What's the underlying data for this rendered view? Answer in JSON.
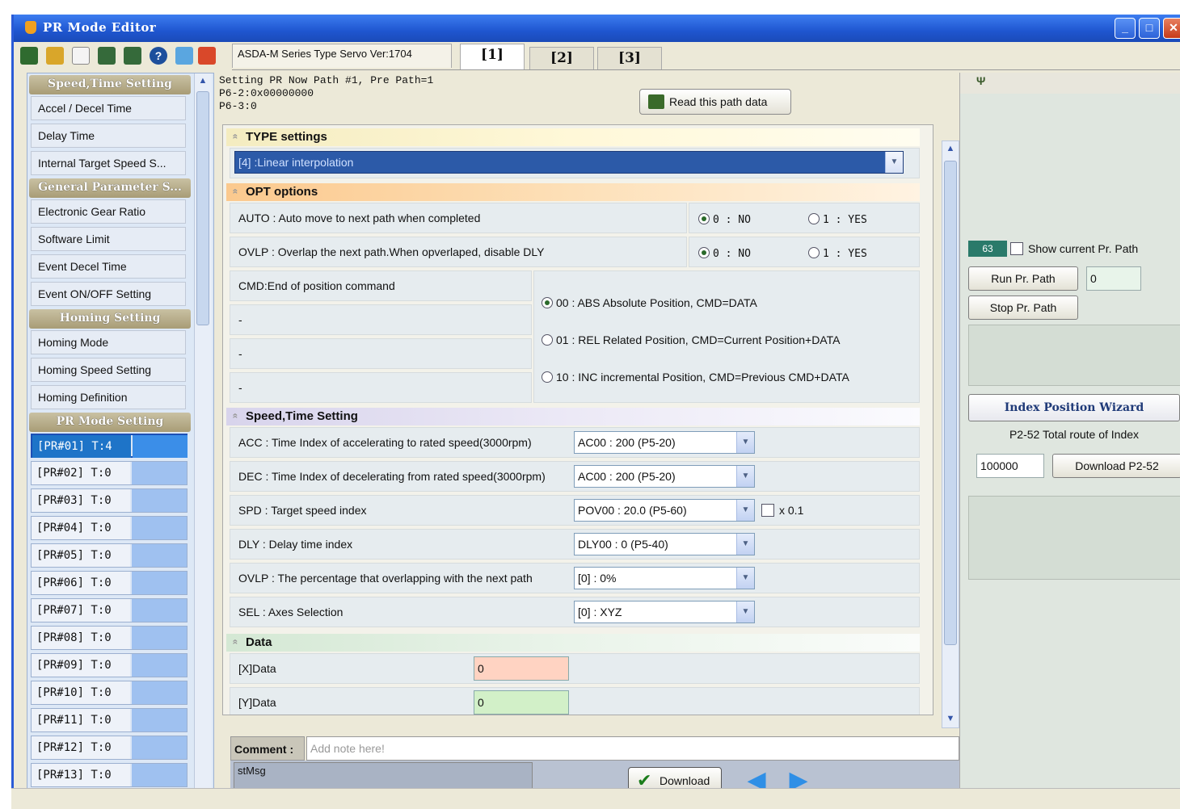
{
  "window": {
    "title": "PR Mode Editor"
  },
  "toolbar": {
    "version_label": "ASDA-M Series Type Servo Ver:1704",
    "tabs": [
      "[1]",
      "[2]",
      "[3]"
    ],
    "icons": [
      "save-icon",
      "open-folder-icon",
      "new-file-icon",
      "read-from-drive-icon",
      "write-to-drive-icon",
      "help-icon",
      "wizard-icon",
      "exit-icon"
    ]
  },
  "sidebar": {
    "groups": {
      "speed_time": "Speed,Time Setting",
      "general": "General Parameter S...",
      "homing": "Homing Setting",
      "pr_mode": "PR Mode Setting"
    },
    "speed_items": [
      "Accel / Decel Time",
      "Delay Time",
      "Internal Target Speed S..."
    ],
    "general_items": [
      "Electronic Gear Ratio",
      "Software Limit",
      "Event Decel Time",
      "Event ON/OFF Setting"
    ],
    "homing_items": [
      "Homing Mode",
      "Homing Speed Setting",
      "Homing Definition"
    ],
    "pr_items": [
      "[PR#01]  T:4",
      "[PR#02]  T:0",
      "[PR#03]  T:0",
      "[PR#04]  T:0",
      "[PR#05]  T:0",
      "[PR#06]  T:0",
      "[PR#07]  T:0",
      "[PR#08]  T:0",
      "[PR#09]  T:0",
      "[PR#10]  T:0",
      "[PR#11]  T:0",
      "[PR#12]  T:0",
      "[PR#13]  T:0"
    ]
  },
  "main": {
    "path_info_line1": "Setting PR Now Path #1, Pre Path=1",
    "path_info_line2": "P6-2:0x00000000",
    "path_info_line3": "P6-3:0",
    "read_button": "Read this path data",
    "type_section": "TYPE settings",
    "type_value": "[4] :Linear interpolation",
    "opt_section": "OPT options",
    "auto_label": "AUTO : Auto move to next path when completed",
    "ovlp_label": "OVLP : Overlap the next path.When opverlaped, disable DLY",
    "no_option": "0 : NO",
    "yes_option": "1 : YES",
    "cmd_label": "CMD:End of position command",
    "dash": "-",
    "cmd_options": [
      "00 : ABS Absolute Position, CMD=DATA",
      "01 : REL Related Position, CMD=Current Position+DATA",
      "10 : INC incremental Position, CMD=Previous CMD+DATA"
    ],
    "speed_section": "Speed,Time Setting",
    "acc_label": "ACC : Time Index of accelerating to rated speed(3000rpm)",
    "acc_value": "AC00 : 200 (P5-20)",
    "dec_label": "DEC : Time Index of decelerating from rated speed(3000rpm)",
    "dec_value": "AC00 : 200 (P5-20)",
    "spd_label": "SPD : Target speed index",
    "spd_value": "POV00 : 20.0 (P5-60)",
    "x01_label": "x 0.1",
    "dly_label": "DLY : Delay time index",
    "dly_value": "DLY00 : 0 (P5-40)",
    "ovlp_pct_label": "OVLP : The percentage that overlapping with the next path",
    "ovlp_pct_value": "[0] : 0%",
    "sel_label": "SEL : Axes Selection",
    "sel_value": "[0] : XYZ",
    "data_section": "Data",
    "x_data_label": "[X]Data",
    "x_data_value": "0",
    "y_data_label": "[Y]Data",
    "y_data_value": "0",
    "comment_label": "Comment :",
    "comment_placeholder": "Add note here!",
    "stmsg": "stMsg",
    "download_button": "Download"
  },
  "right": {
    "pin": "Ψ",
    "pr_count": "63",
    "show_current": "Show current Pr. Path",
    "run_button": "Run Pr. Path",
    "run_value": "0",
    "stop_button": "Stop Pr. Path",
    "wizard_button": "Index Position Wizard",
    "p252_label": "P2-52 Total route of Index",
    "p252_value": "100000",
    "download_p252": "Download P2-52"
  },
  "colors": {
    "title_bar": "#1f56d0",
    "selected_pr": "#1e74c8",
    "type_select": "#2c5aa8",
    "x_data_bg": "#ffd3c2",
    "y_data_bg": "#d2f0c8"
  }
}
